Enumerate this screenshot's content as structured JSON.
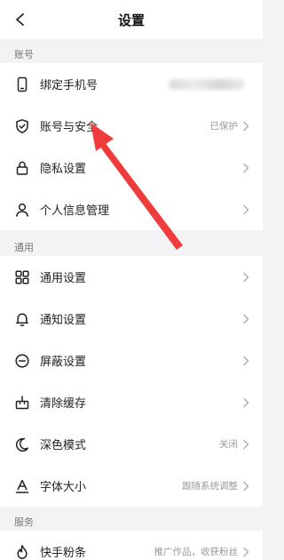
{
  "header": {
    "title": "设置"
  },
  "sections": {
    "account": "账号",
    "general": "通用",
    "service": "服务"
  },
  "account_items": [
    {
      "label": "绑定手机号",
      "value": ""
    },
    {
      "label": "账号与安全",
      "value": "已保护"
    },
    {
      "label": "隐私设置",
      "value": ""
    },
    {
      "label": "个人信息管理",
      "value": ""
    }
  ],
  "general_items": [
    {
      "label": "通用设置",
      "value": ""
    },
    {
      "label": "通知设置",
      "value": ""
    },
    {
      "label": "屏蔽设置",
      "value": ""
    },
    {
      "label": "清除缓存",
      "value": ""
    },
    {
      "label": "深色模式",
      "value": "关闭"
    },
    {
      "label": "字体大小",
      "value": "跟随系统调整"
    }
  ],
  "service_items": [
    {
      "label": "快手粉条",
      "value": "推广作品，收获粉丝"
    }
  ],
  "colors": {
    "annotation_arrow": "#ee3b3b",
    "background": "#f3f3f5"
  }
}
